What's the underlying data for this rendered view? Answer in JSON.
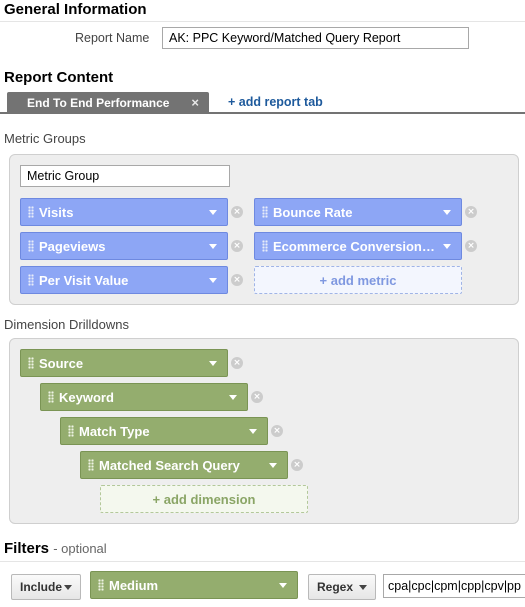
{
  "general": {
    "title": "General Information",
    "report_name_label": "Report Name",
    "report_name_value": "AK: PPC Keyword/Matched Query Report"
  },
  "content": {
    "title": "Report Content",
    "active_tab": "End To End Performance",
    "tab_close": "×",
    "add_tab": "+ add report tab"
  },
  "metrics": {
    "title": "Metric Groups",
    "group_name": "Metric Group",
    "items": [
      "Visits",
      "Bounce Rate",
      "Pageviews",
      "Ecommerce Conversion Rate",
      "Per Visit Value"
    ],
    "add_label": "+ add metric",
    "color": "#8da6f5"
  },
  "dimensions": {
    "title": "Dimension Drilldowns",
    "items": [
      "Source",
      "Keyword",
      "Match Type",
      "Matched Search Query"
    ],
    "add_label": "+ add dimension",
    "color": "#94ad6e"
  },
  "filters": {
    "title": "Filters",
    "optional": "- optional",
    "include_label": "Include",
    "dimension": "Medium",
    "match_type": "Regex",
    "value": "cpa|cpc|cpm|cpp|cpv|ppc"
  },
  "icons": {
    "remove": "×"
  }
}
